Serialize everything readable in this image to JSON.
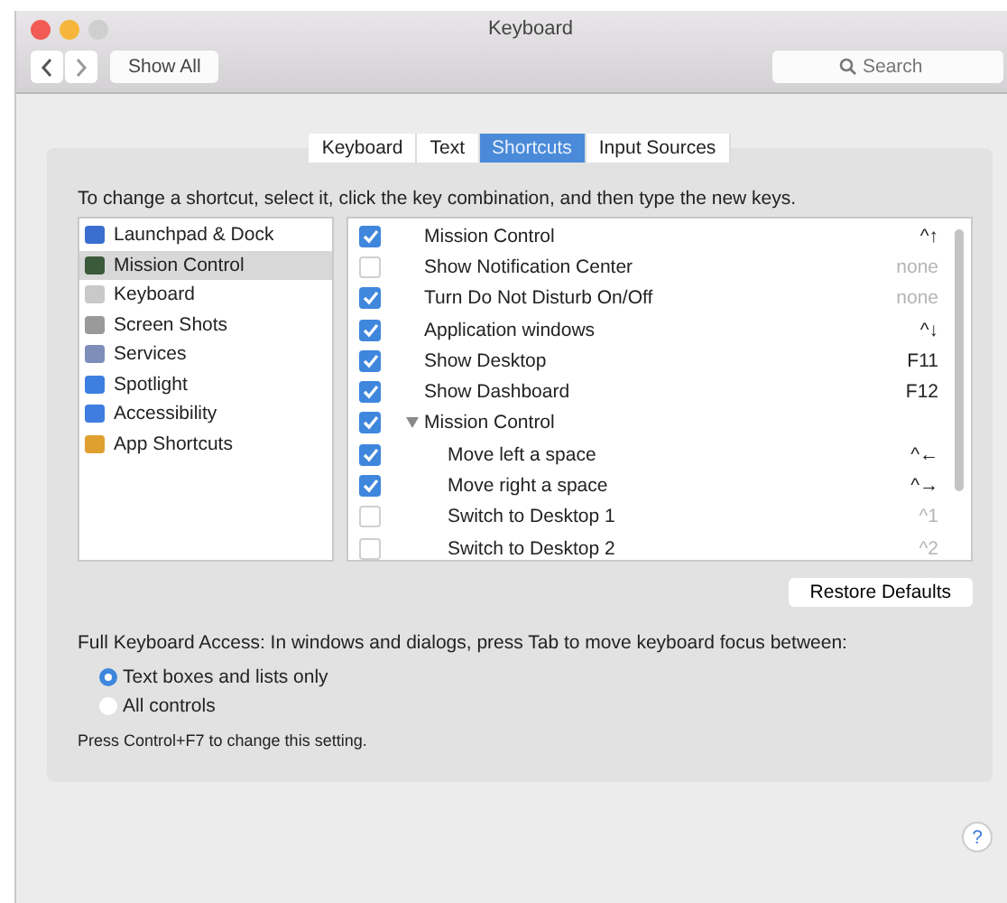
{
  "window": {
    "title": "Keyboard"
  },
  "toolbar": {
    "show_all": "Show All",
    "search": {
      "placeholder": "Search"
    }
  },
  "tabs": [
    {
      "label": "Keyboard",
      "selected": false
    },
    {
      "label": "Text",
      "selected": false
    },
    {
      "label": "Shortcuts",
      "selected": true
    },
    {
      "label": "Input Sources",
      "selected": false
    }
  ],
  "instruction": "To change a shortcut, select it, click the key combination, and then type the new keys.",
  "categories": [
    {
      "label": "Launchpad & Dock",
      "selected": false
    },
    {
      "label": "Mission Control",
      "selected": true
    },
    {
      "label": "Keyboard",
      "selected": false
    },
    {
      "label": "Screen Shots",
      "selected": false
    },
    {
      "label": "Services",
      "selected": false
    },
    {
      "label": "Spotlight",
      "selected": false
    },
    {
      "label": "Accessibility",
      "selected": false
    },
    {
      "label": "App Shortcuts",
      "selected": false
    }
  ],
  "shortcuts": [
    {
      "label": "Mission Control",
      "checked": true,
      "keys": "^↑",
      "dim": false
    },
    {
      "label": "Show Notification Center",
      "checked": false,
      "keys": "none",
      "dim": true
    },
    {
      "label": "Turn Do Not Disturb On/Off",
      "checked": true,
      "keys": "none",
      "dim": true
    },
    {
      "label": "Application windows",
      "checked": true,
      "keys": "^↓",
      "dim": false
    },
    {
      "label": "Show Desktop",
      "checked": true,
      "keys": "F11",
      "dim": false
    },
    {
      "label": "Show Dashboard",
      "checked": true,
      "keys": "F12",
      "dim": false
    },
    {
      "label": "Mission Control",
      "checked": true,
      "expanded": true,
      "children": [
        {
          "label": "Move left a space",
          "checked": true,
          "keys": "^←",
          "dim": false
        },
        {
          "label": "Move right a space",
          "checked": true,
          "keys": "^→",
          "dim": false
        },
        {
          "label": "Switch to Desktop 1",
          "checked": false,
          "keys": "^1",
          "dim": true
        },
        {
          "label": "Switch to Desktop 2",
          "checked": false,
          "keys": "^2",
          "dim": true
        }
      ]
    }
  ],
  "restore_button": "Restore Defaults",
  "full_access": {
    "label": "Full Keyboard Access: In windows and dialogs, press Tab to move keyboard focus between:",
    "options": [
      {
        "label": "Text boxes and lists only",
        "selected": true
      },
      {
        "label": "All controls",
        "selected": false
      }
    ],
    "note": "Press Control+F7 to change this setting."
  },
  "help": "?"
}
